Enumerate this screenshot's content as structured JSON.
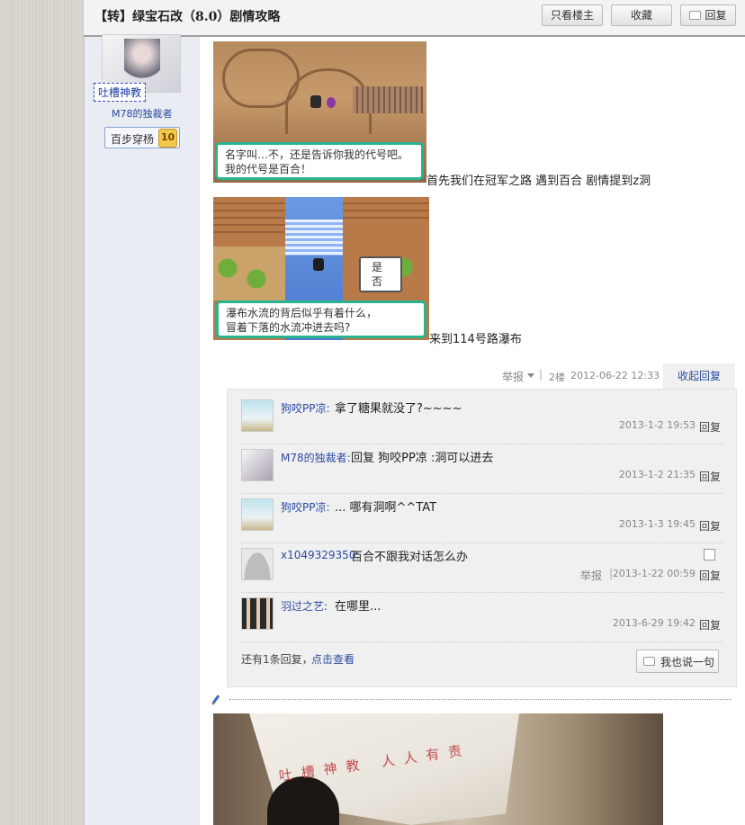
{
  "thread": {
    "title": "【转】绿宝石改（8.0）剧情攻略",
    "buttons": {
      "only_op": "只看楼主",
      "favorite": "收藏",
      "reply": "回复"
    }
  },
  "author": {
    "name": "吐槽神教",
    "title": "M78的独裁者",
    "badge_label": "百步穿杨",
    "badge_level": "10"
  },
  "post": {
    "image1_dialog": "名字叫…不，还是告诉你我的代号吧。\n我的代号是百合！",
    "caption1": "首先我们在冠军之路 遇到百合 剧情提到z洞",
    "image2_dialog": "瀑布水流的背后似乎有着什么，\n冒着下落的水流冲进去吗?",
    "image2_choice_yes": "是",
    "image2_choice_no": "否",
    "caption2": "来到114号路瀑布",
    "meta": {
      "report": "举报",
      "floor": "2楼",
      "datetime": "2012-06-22 12:33",
      "collapse": "收起回复"
    }
  },
  "replies": [
    {
      "user": "狗咬PP凉:",
      "text": "拿了糖果就没了?~~~~",
      "time": "2013-1-2 19:53",
      "reply": "回复"
    },
    {
      "user": "M78的独裁者:",
      "text": "回复 狗咬PP凉 :洞可以进去",
      "time": "2013-1-2 21:35",
      "reply": "回复"
    },
    {
      "user": "狗咬PP凉:",
      "text": "... 哪有洞啊^^TAT",
      "time": "2013-1-3 19:45",
      "reply": "回复"
    },
    {
      "user": "x1049329350:",
      "text": "百合不跟我对话怎么办",
      "time": "2013-1-22 00:59",
      "reply": "回复",
      "report": "举报"
    },
    {
      "user": "羽过之艺:",
      "text": "在哪里...",
      "time": "2013-6-29 19:42",
      "reply": "回复"
    }
  ],
  "more_replies": {
    "text": "还有1条回复，",
    "link": "点击查看",
    "say_button": "我也说一句"
  },
  "photo_text": "吐槽神教 人人有责",
  "colors": {
    "link": "#2b4aa0",
    "dialog_border": "#29b38f"
  }
}
